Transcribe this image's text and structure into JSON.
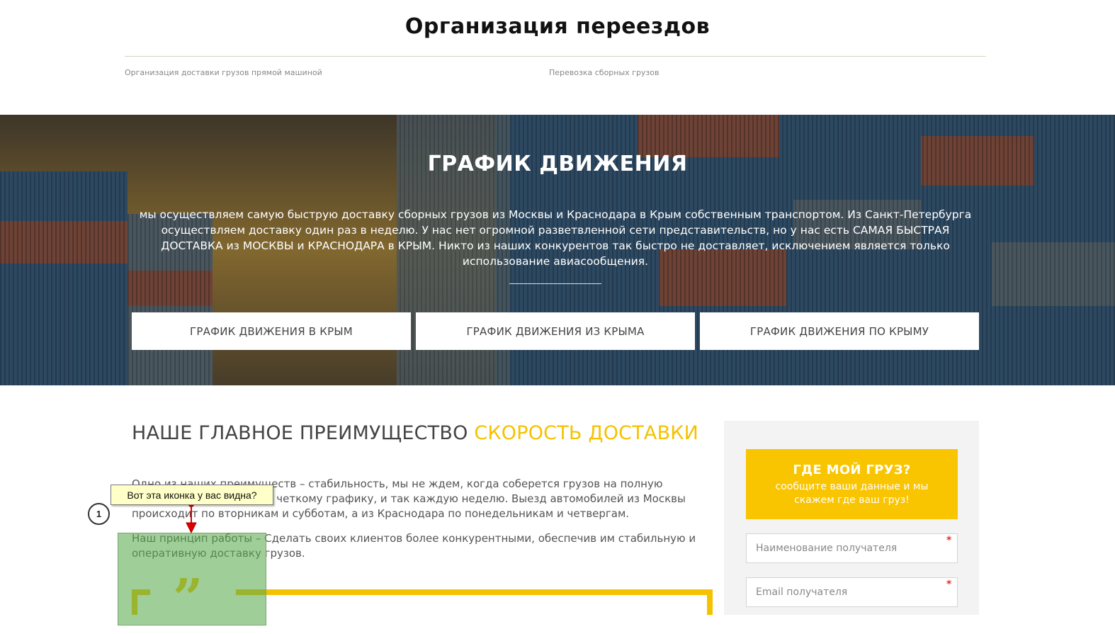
{
  "top": {
    "title": "Организация переездов",
    "links": [
      "Организация доставки грузов прямой машиной",
      "Перевозка сборных грузов"
    ]
  },
  "hero": {
    "title": "ГРАФИК ДВИЖЕНИЯ",
    "text": "мы осуществляем самую быструю доставку сборных грузов из Москвы и Краснодара в Крым собственным транспортом. Из Санкт-Петербурга осуществляем доставку один раз в неделю. У нас нет огромной разветвленной сети представительств, но у нас есть САМАЯ БЫСТРАЯ ДОСТАВКА из МОСКВЫ и КРАСНОДАРА в КРЫМ. Никто из наших конкурентов так быстро не доставляет, исключением является только использование авиасообщения.",
    "buttons": [
      "ГРАФИК ДВИЖЕНИЯ В КРЫМ",
      "ГРАФИК ДВИЖЕНИЯ ИЗ КРЫМА",
      "ГРАФИК ДВИЖЕНИЯ ПО КРЫМУ"
    ]
  },
  "advantage": {
    "title_main": "НАШЕ ГЛАВНОЕ ПРЕИМУЩЕСТВО ",
    "title_highlight": "СКОРОСТЬ ДОСТАВКИ",
    "paragraph1": "Одно из наших преимуществ – стабильность, мы не ждем, когда соберется грузов на полную машину, мы работаем по четкому графику, и так каждую неделю. Выезд автомобилей из Москвы происходит по вторникам и субботам, а из Краснодара по понедельникам и четвергам.",
    "paragraph2": "Наш принцип работы – Сделать своих клиентов более конкурентными, обеспечив им стабильную и оперативную доставку грузов.",
    "quote_icon": "quote-icon"
  },
  "annotation": {
    "tooltip": "Вот эта иконка у вас видна?",
    "number": "1"
  },
  "sidebar": {
    "card_title": "ГДЕ МОЙ ГРУЗ?",
    "card_text": "сообщите ваши данные и мы скажем где ваш груз!",
    "recipient_placeholder": "Наименование получателя",
    "email_placeholder": "Email получателя",
    "required_mark": "*"
  },
  "colors": {
    "accent": "#f5c200",
    "card": "#f9c400",
    "annotation_green": "#5aaa50",
    "tooltip_bg": "#ffffc8"
  }
}
